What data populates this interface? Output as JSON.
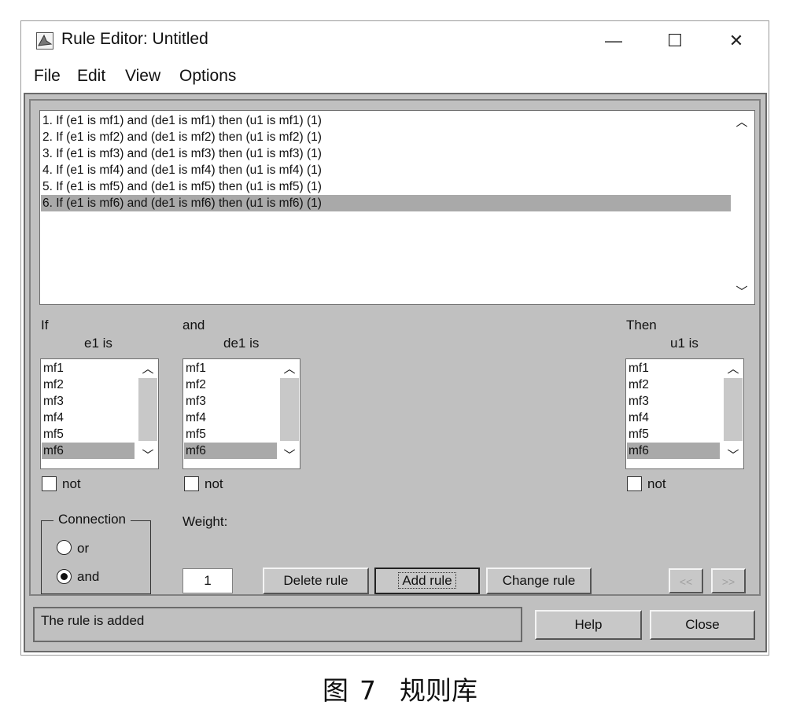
{
  "window": {
    "title": "Rule Editor: Untitled",
    "controls": {
      "minimize": "—",
      "maximize": "☐",
      "close": "✕"
    }
  },
  "menu": [
    "File",
    "Edit",
    "View",
    "Options"
  ],
  "rules": {
    "items": [
      "1. If (e1 is mf1) and (de1 is mf1) then (u1 is mf1) (1)",
      "2. If (e1 is mf2) and (de1 is mf2) then (u1 is mf2) (1)",
      "3. If (e1 is mf3) and (de1 is mf3) then (u1 is mf3) (1)",
      "4. If (e1 is mf4) and (de1 is mf4) then (u1 is mf4) (1)",
      "5. If (e1 is mf5) and (de1 is mf5) then (u1 is mf5) (1)",
      "6. If (e1 is mf6) and (de1 is mf6) then (u1 is mf6) (1)"
    ],
    "selected_index": 5
  },
  "if_label": "If",
  "and_label": "and",
  "then_label": "Then",
  "inputs": {
    "e1": {
      "label": "e1 is",
      "items": [
        "mf1",
        "mf2",
        "mf3",
        "mf4",
        "mf5",
        "mf6"
      ],
      "selected": "mf6",
      "not_label": "not"
    },
    "de1": {
      "label": "de1 is",
      "items": [
        "mf1",
        "mf2",
        "mf3",
        "mf4",
        "mf5",
        "mf6"
      ],
      "selected": "mf6",
      "not_label": "not"
    }
  },
  "output": {
    "u1": {
      "label": "u1 is",
      "items": [
        "mf1",
        "mf2",
        "mf3",
        "mf4",
        "mf5",
        "mf6"
      ],
      "selected": "mf6",
      "not_label": "not"
    }
  },
  "connection": {
    "title": "Connection",
    "options": [
      "or",
      "and"
    ],
    "selected": "and"
  },
  "weight": {
    "label": "Weight:",
    "value": "1"
  },
  "buttons": {
    "delete": "Delete rule",
    "add": "Add rule",
    "change": "Change rule",
    "prev": "<<",
    "next": ">>",
    "help": "Help",
    "close": "Close"
  },
  "status": "The rule is added",
  "caption": {
    "prefix": "图",
    "number": "7",
    "text": "规则库"
  }
}
